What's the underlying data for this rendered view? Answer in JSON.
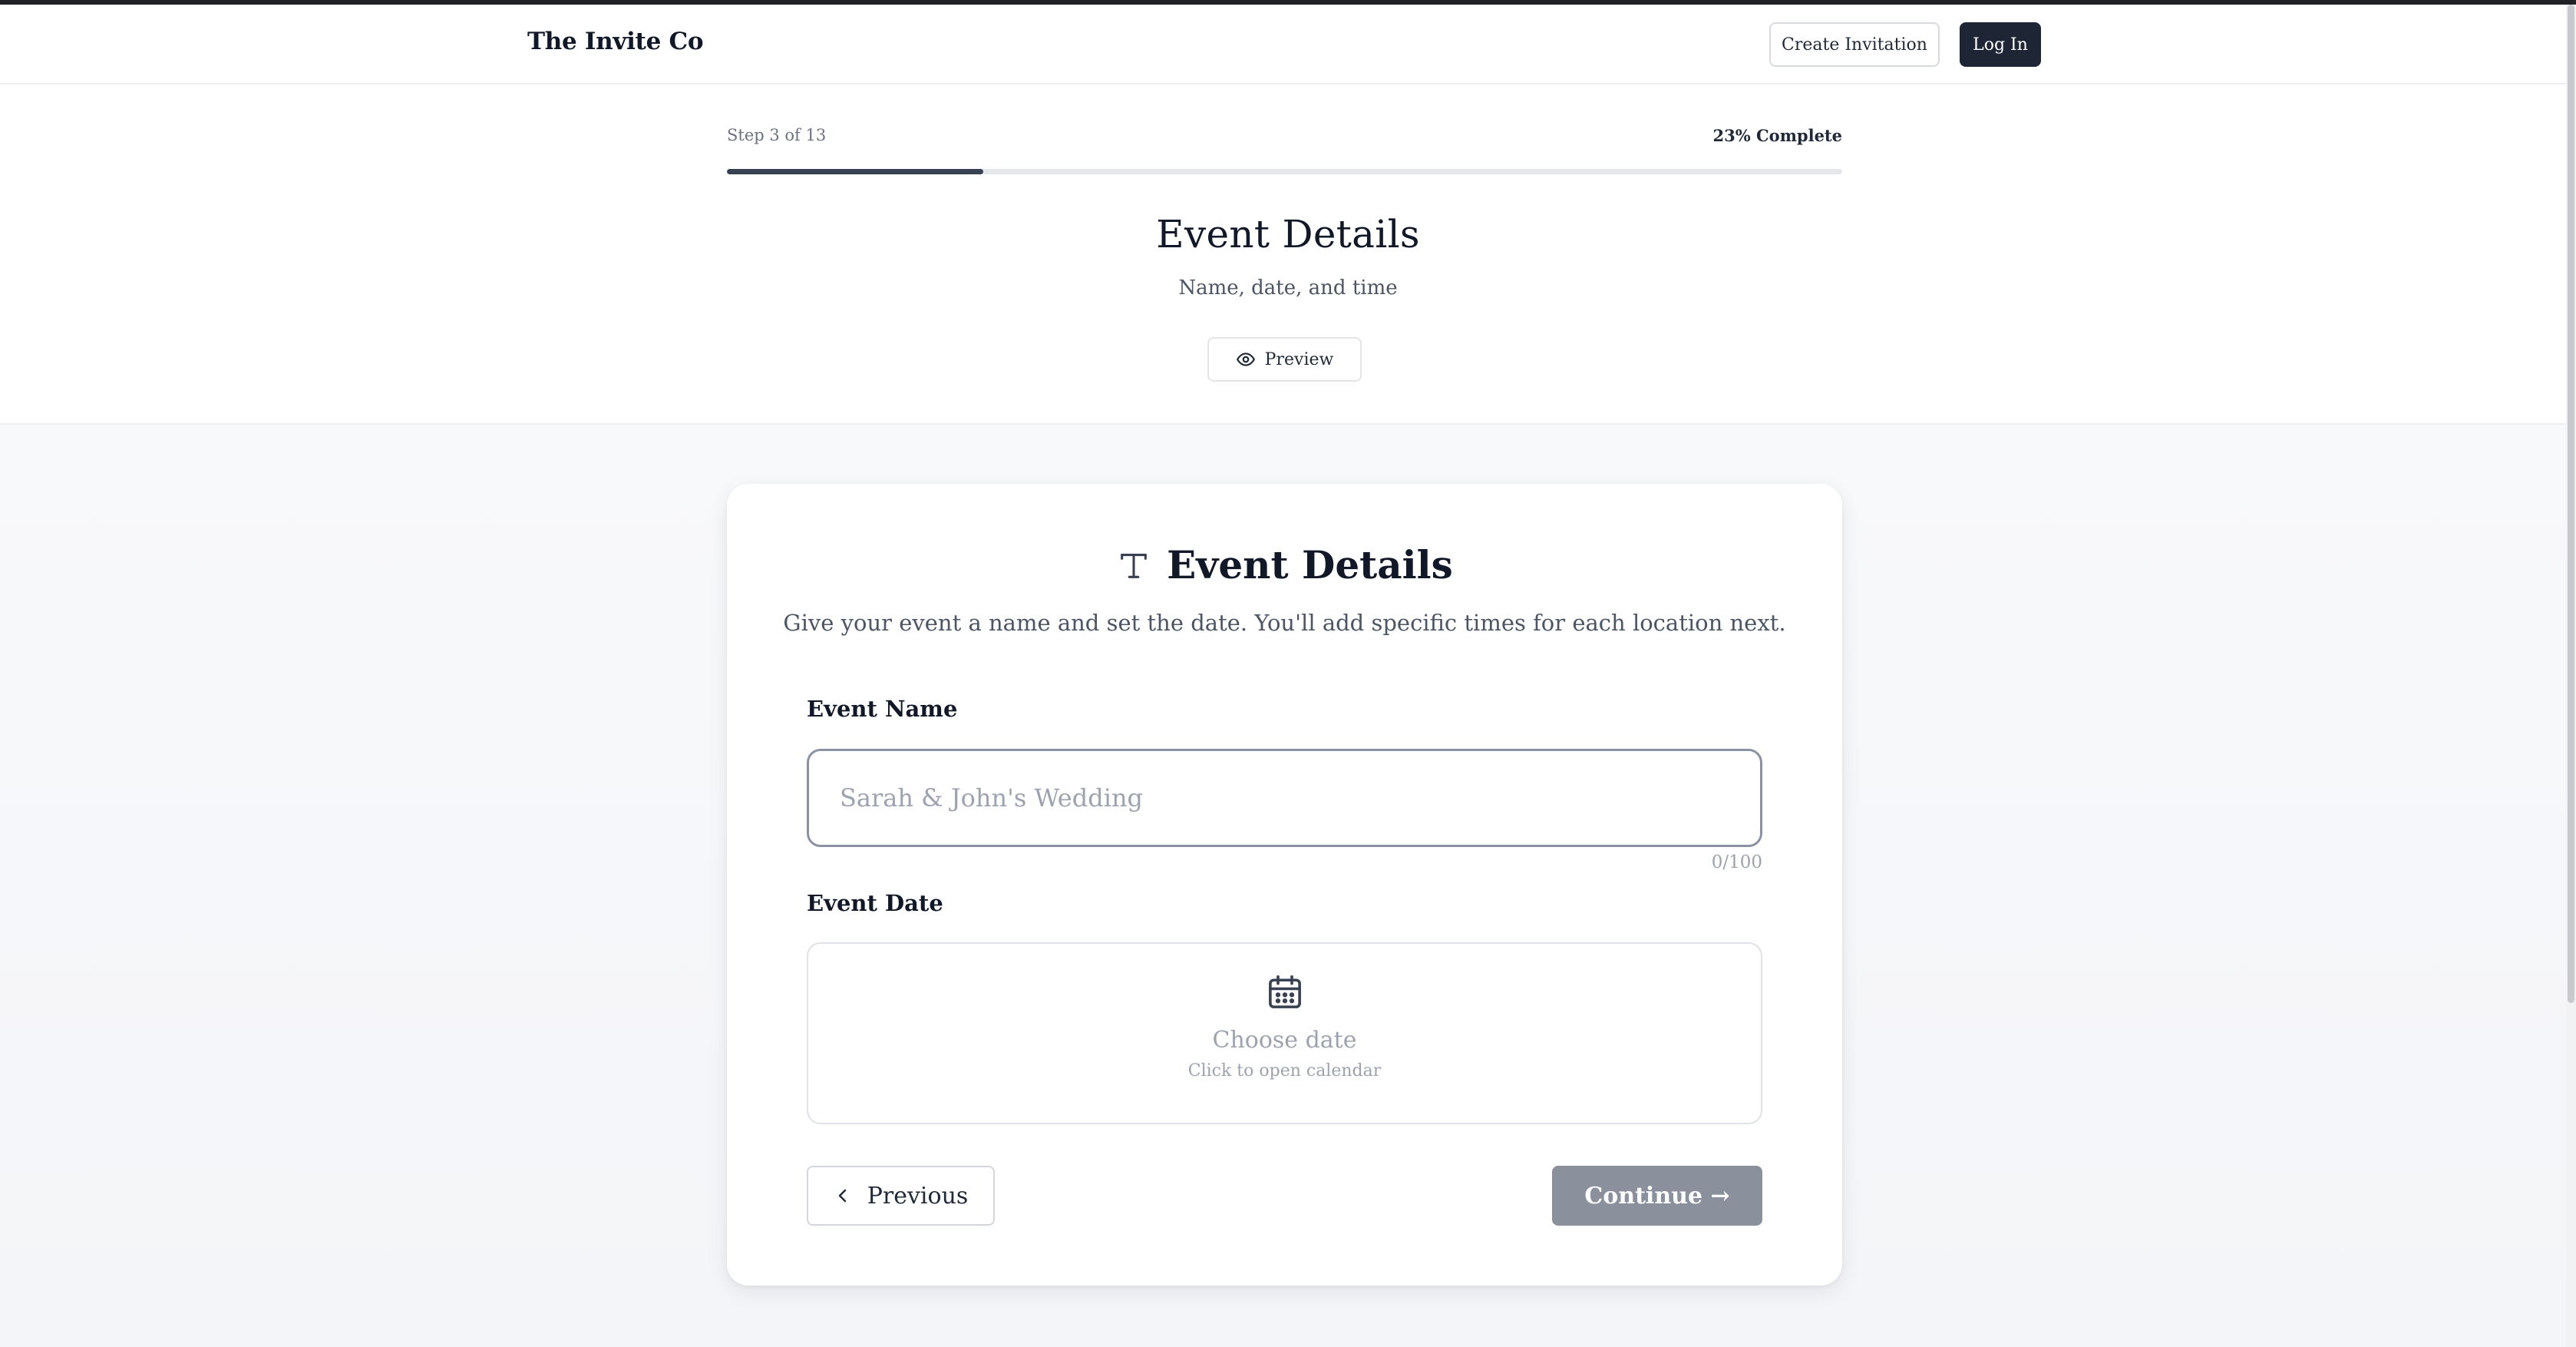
{
  "header": {
    "brand": "The Invite Co",
    "create_label": "Create Invitation",
    "login_label": "Log In"
  },
  "progress": {
    "step_text": "Step 3 of 13",
    "complete_text": "23% Complete",
    "percent": 23
  },
  "section": {
    "title": "Event Details",
    "subtitle": "Name, date, and time",
    "preview_label": "Preview",
    "preview_icon": "eye-icon"
  },
  "card": {
    "icon": "text-type-icon",
    "title": "Event Details",
    "description": "Give your event a name and set the date. You'll add specific times for each location next.",
    "event_name": {
      "label": "Event Name",
      "value": "",
      "placeholder": "Sarah & John's Wedding",
      "counter": "0/100"
    },
    "event_date": {
      "label": "Event Date",
      "icon": "calendar-icon",
      "main_text": "Choose date",
      "sub_text": "Click to open calendar"
    },
    "prev_label": "Previous",
    "continue_label": "Continue →"
  },
  "colors": {
    "primary_dark": "#1e2535",
    "continue_disabled": "#8b919c",
    "progress_fill": "#374151",
    "muted_text": "#9ca3af"
  }
}
